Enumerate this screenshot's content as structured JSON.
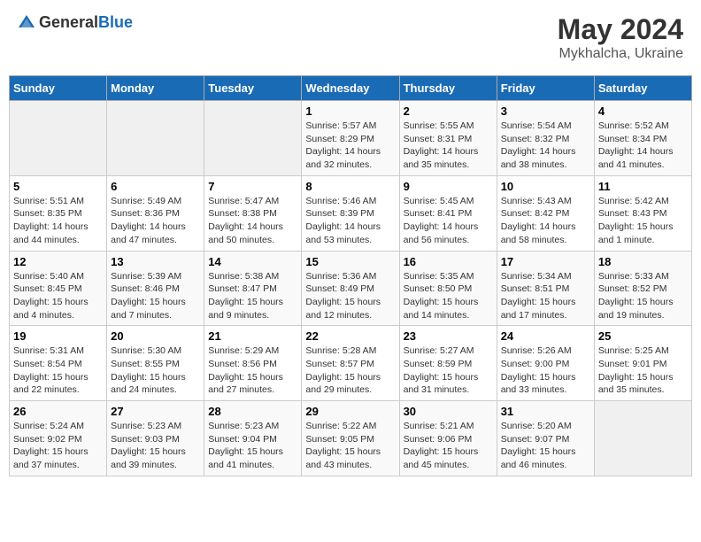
{
  "header": {
    "logo_general": "General",
    "logo_blue": "Blue",
    "title": "May 2024",
    "subtitle": "Mykhalcha, Ukraine"
  },
  "days_of_week": [
    "Sunday",
    "Monday",
    "Tuesday",
    "Wednesday",
    "Thursday",
    "Friday",
    "Saturday"
  ],
  "weeks": [
    [
      {
        "day": "",
        "info": ""
      },
      {
        "day": "",
        "info": ""
      },
      {
        "day": "",
        "info": ""
      },
      {
        "day": "1",
        "info": "Sunrise: 5:57 AM\nSunset: 8:29 PM\nDaylight: 14 hours\nand 32 minutes."
      },
      {
        "day": "2",
        "info": "Sunrise: 5:55 AM\nSunset: 8:31 PM\nDaylight: 14 hours\nand 35 minutes."
      },
      {
        "day": "3",
        "info": "Sunrise: 5:54 AM\nSunset: 8:32 PM\nDaylight: 14 hours\nand 38 minutes."
      },
      {
        "day": "4",
        "info": "Sunrise: 5:52 AM\nSunset: 8:34 PM\nDaylight: 14 hours\nand 41 minutes."
      }
    ],
    [
      {
        "day": "5",
        "info": "Sunrise: 5:51 AM\nSunset: 8:35 PM\nDaylight: 14 hours\nand 44 minutes."
      },
      {
        "day": "6",
        "info": "Sunrise: 5:49 AM\nSunset: 8:36 PM\nDaylight: 14 hours\nand 47 minutes."
      },
      {
        "day": "7",
        "info": "Sunrise: 5:47 AM\nSunset: 8:38 PM\nDaylight: 14 hours\nand 50 minutes."
      },
      {
        "day": "8",
        "info": "Sunrise: 5:46 AM\nSunset: 8:39 PM\nDaylight: 14 hours\nand 53 minutes."
      },
      {
        "day": "9",
        "info": "Sunrise: 5:45 AM\nSunset: 8:41 PM\nDaylight: 14 hours\nand 56 minutes."
      },
      {
        "day": "10",
        "info": "Sunrise: 5:43 AM\nSunset: 8:42 PM\nDaylight: 14 hours\nand 58 minutes."
      },
      {
        "day": "11",
        "info": "Sunrise: 5:42 AM\nSunset: 8:43 PM\nDaylight: 15 hours\nand 1 minute."
      }
    ],
    [
      {
        "day": "12",
        "info": "Sunrise: 5:40 AM\nSunset: 8:45 PM\nDaylight: 15 hours\nand 4 minutes."
      },
      {
        "day": "13",
        "info": "Sunrise: 5:39 AM\nSunset: 8:46 PM\nDaylight: 15 hours\nand 7 minutes."
      },
      {
        "day": "14",
        "info": "Sunrise: 5:38 AM\nSunset: 8:47 PM\nDaylight: 15 hours\nand 9 minutes."
      },
      {
        "day": "15",
        "info": "Sunrise: 5:36 AM\nSunset: 8:49 PM\nDaylight: 15 hours\nand 12 minutes."
      },
      {
        "day": "16",
        "info": "Sunrise: 5:35 AM\nSunset: 8:50 PM\nDaylight: 15 hours\nand 14 minutes."
      },
      {
        "day": "17",
        "info": "Sunrise: 5:34 AM\nSunset: 8:51 PM\nDaylight: 15 hours\nand 17 minutes."
      },
      {
        "day": "18",
        "info": "Sunrise: 5:33 AM\nSunset: 8:52 PM\nDaylight: 15 hours\nand 19 minutes."
      }
    ],
    [
      {
        "day": "19",
        "info": "Sunrise: 5:31 AM\nSunset: 8:54 PM\nDaylight: 15 hours\nand 22 minutes."
      },
      {
        "day": "20",
        "info": "Sunrise: 5:30 AM\nSunset: 8:55 PM\nDaylight: 15 hours\nand 24 minutes."
      },
      {
        "day": "21",
        "info": "Sunrise: 5:29 AM\nSunset: 8:56 PM\nDaylight: 15 hours\nand 27 minutes."
      },
      {
        "day": "22",
        "info": "Sunrise: 5:28 AM\nSunset: 8:57 PM\nDaylight: 15 hours\nand 29 minutes."
      },
      {
        "day": "23",
        "info": "Sunrise: 5:27 AM\nSunset: 8:59 PM\nDaylight: 15 hours\nand 31 minutes."
      },
      {
        "day": "24",
        "info": "Sunrise: 5:26 AM\nSunset: 9:00 PM\nDaylight: 15 hours\nand 33 minutes."
      },
      {
        "day": "25",
        "info": "Sunrise: 5:25 AM\nSunset: 9:01 PM\nDaylight: 15 hours\nand 35 minutes."
      }
    ],
    [
      {
        "day": "26",
        "info": "Sunrise: 5:24 AM\nSunset: 9:02 PM\nDaylight: 15 hours\nand 37 minutes."
      },
      {
        "day": "27",
        "info": "Sunrise: 5:23 AM\nSunset: 9:03 PM\nDaylight: 15 hours\nand 39 minutes."
      },
      {
        "day": "28",
        "info": "Sunrise: 5:23 AM\nSunset: 9:04 PM\nDaylight: 15 hours\nand 41 minutes."
      },
      {
        "day": "29",
        "info": "Sunrise: 5:22 AM\nSunset: 9:05 PM\nDaylight: 15 hours\nand 43 minutes."
      },
      {
        "day": "30",
        "info": "Sunrise: 5:21 AM\nSunset: 9:06 PM\nDaylight: 15 hours\nand 45 minutes."
      },
      {
        "day": "31",
        "info": "Sunrise: 5:20 AM\nSunset: 9:07 PM\nDaylight: 15 hours\nand 46 minutes."
      },
      {
        "day": "",
        "info": ""
      }
    ]
  ]
}
